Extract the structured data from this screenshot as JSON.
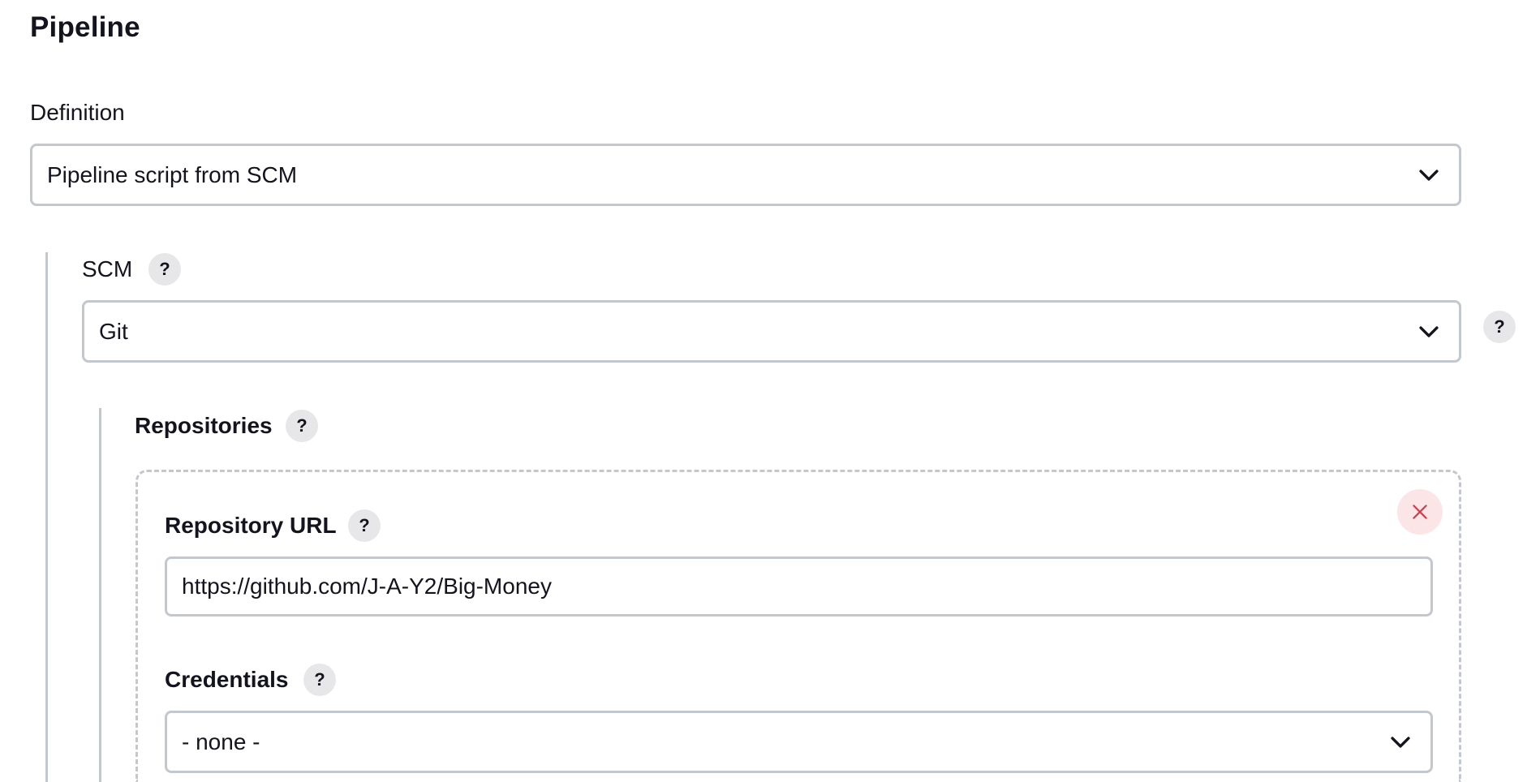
{
  "pipeline": {
    "title": "Pipeline",
    "definition": {
      "label": "Definition",
      "selected": "Pipeline script from SCM"
    },
    "scm": {
      "label": "SCM",
      "help": "?",
      "selected": "Git",
      "select_help": "?"
    },
    "repositories": {
      "label": "Repositories",
      "help": "?",
      "items": [
        {
          "url_label": "Repository URL",
          "url_help": "?",
          "url_value": "https://github.com/J-A-Y2/Big-Money",
          "credentials_label": "Credentials",
          "credentials_help": "?",
          "credentials_selected": "- none -"
        }
      ]
    }
  },
  "colors": {
    "border": "#c3c8cf",
    "help_bg": "#e7e7ea",
    "delete_bg": "#fbe5e7",
    "delete_icon": "#d33a4a",
    "text": "#14141f"
  },
  "icons": {
    "dropdown": "chevron-down-icon",
    "delete": "close-icon"
  }
}
